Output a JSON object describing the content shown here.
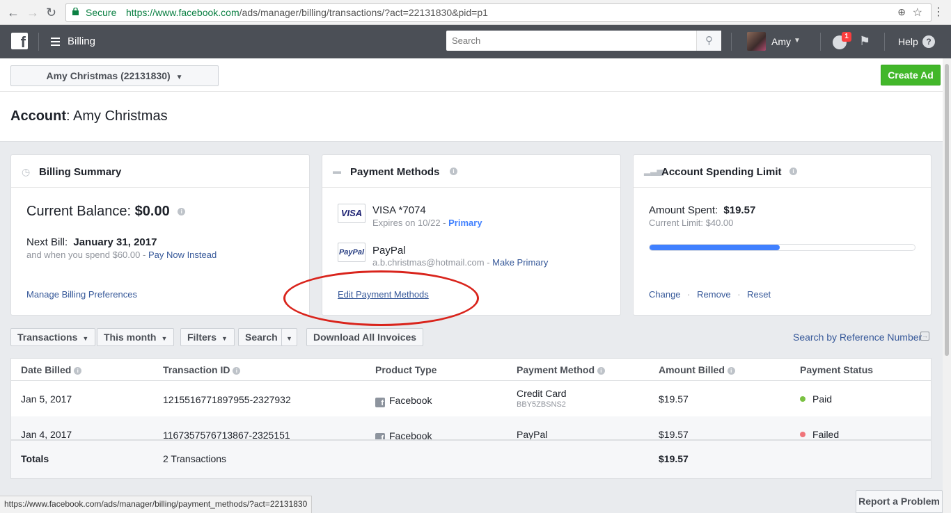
{
  "browser": {
    "secure_label": "Secure",
    "url_base": "https://www.facebook.com",
    "url_path": "/ads/manager/billing/transactions/?act=22131830&pid=p1",
    "status_url": "https://www.facebook.com/ads/manager/billing/payment_methods/?act=22131830"
  },
  "topbar": {
    "logo": "f",
    "section": "Billing",
    "search_placeholder": "Search",
    "username": "Amy",
    "notif_count": "1",
    "help": "Help",
    "help_q": "?"
  },
  "header": {
    "account_selector": "Amy Christmas (22131830)",
    "create_ad": "Create Ad",
    "account_label": "Account",
    "account_name": ": Amy Christmas"
  },
  "billing_summary": {
    "title": "Billing Summary",
    "balance_label": "Current Balance:",
    "balance_value": "$0.00",
    "next_bill_label": "Next Bill:",
    "next_bill_date": "January 31, 2017",
    "spend_text": "and when you spend $60.00 -",
    "pay_now": "Pay Now Instead",
    "manage_link": "Manage Billing Preferences"
  },
  "payment_methods": {
    "title": "Payment Methods",
    "methods": [
      {
        "logo": "VISA",
        "name": "VISA *7074",
        "detail": "Expires on 10/22 -",
        "action": "Primary"
      },
      {
        "logo": "PayPal",
        "name": "PayPal",
        "detail": "a.b.christmas@hotmail.com -",
        "action": "Make Primary"
      }
    ],
    "edit_link": "Edit Payment Methods"
  },
  "spending_limit": {
    "title": "Account Spending Limit",
    "spent_label": "Amount Spent:",
    "spent_value": "$19.57",
    "limit_text": "Current Limit: $40.00",
    "progress_fraction": 0.49,
    "actions": [
      "Change",
      "Remove",
      "Reset"
    ],
    "separator": "·"
  },
  "filters": {
    "transactions": "Transactions",
    "period": "This month",
    "filters": "Filters",
    "search": "Search",
    "download": "Download All Invoices",
    "search_ref": "Search by Reference Number"
  },
  "table": {
    "headers": [
      "Date Billed",
      "Transaction ID",
      "Product Type",
      "Payment Method",
      "Amount Billed",
      "Payment Status"
    ],
    "rows": [
      {
        "date": "Jan 5, 2017",
        "txn": "1215516771897955-2327932",
        "product": "Facebook",
        "method": "Credit Card",
        "method_sub": "BBY5ZBSNS2",
        "amount": "$19.57",
        "status": "Paid",
        "status_color": "#7ac142"
      },
      {
        "date": "Jan 4, 2017",
        "txn": "1167357576713867-2325151",
        "product": "Facebook",
        "method": "PayPal",
        "method_sub": "",
        "amount": "$19.57",
        "status": "Failed",
        "status_color": "#f0747a"
      }
    ],
    "totals_label": "Totals",
    "totals_count": "2 Transactions",
    "totals_amount": "$19.57"
  },
  "footer": {
    "report": "Report a Problem"
  },
  "colors": {
    "accent_green": "#42b72a",
    "link_blue": "#365899",
    "progress_blue": "#4080ff",
    "annotation_red": "#d9241c"
  }
}
